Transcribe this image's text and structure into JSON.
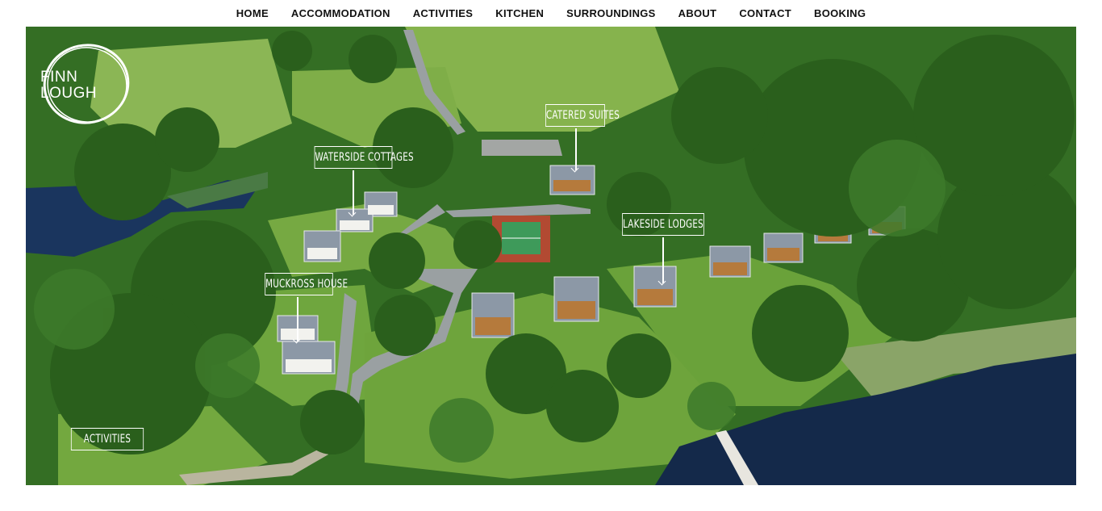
{
  "nav": {
    "items": [
      {
        "label": "HOME"
      },
      {
        "label": "ACCOMMODATION"
      },
      {
        "label": "ACTIVITIES"
      },
      {
        "label": "KITCHEN"
      },
      {
        "label": "SURROUNDINGS"
      },
      {
        "label": "ABOUT"
      },
      {
        "label": "CONTACT"
      },
      {
        "label": "BOOKING"
      }
    ]
  },
  "logo": {
    "line1": "FINN",
    "line2": "LOUGH"
  },
  "map_labels": {
    "catered_suites": "CATERED SUITES",
    "waterside_cottages": "WATERSIDE COTTAGES",
    "lakeside_lodges": "LAKESIDE LODGES",
    "muckross_house": "MUCKROSS HOUSE",
    "activities": "ACTIVITIES"
  },
  "colors": {
    "forest": "#2f6a22",
    "field": "#7fb24a",
    "lake": "#14294a",
    "road": "#9aa0a2"
  }
}
